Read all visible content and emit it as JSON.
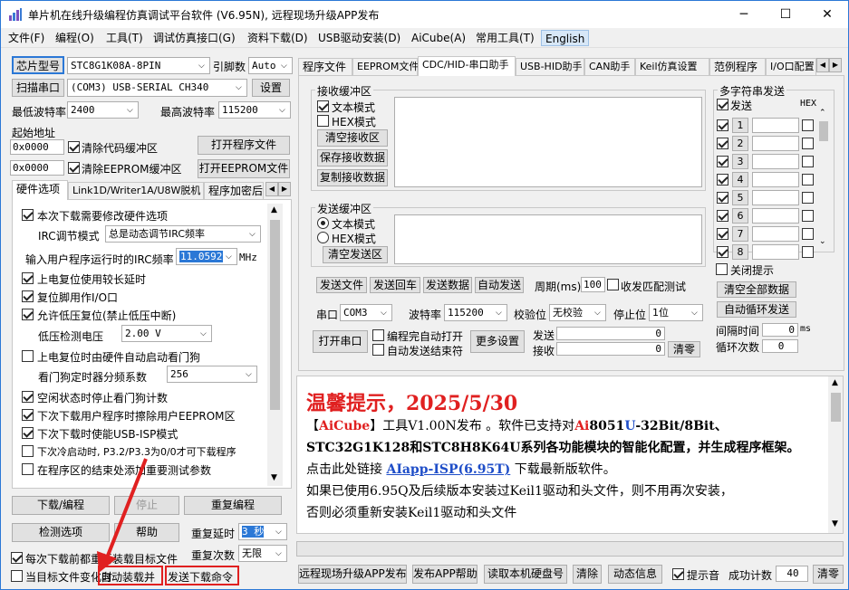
{
  "window": {
    "title": "单片机在线升级编程仿真调试平台软件 (V6.95N), 远程现场升级APP发布"
  },
  "menu": [
    "文件(F)",
    "编程(O)",
    "工具(T)",
    "调试仿真接口(G)",
    "资料下载(D)",
    "USB驱动安装(D)",
    "AiCube(A)",
    "常用工具(T)",
    "English"
  ],
  "left": {
    "chip_btn": "芯片型号",
    "chip_value": "STC8G1K08A-8PIN",
    "pin_label": "引脚数",
    "pin_value": "Auto",
    "scan_btn": "扫描串口",
    "port_value": "(COM3) USB-SERIAL CH340",
    "settings_btn": "设置",
    "min_baud_label": "最低波特率",
    "min_baud_value": "2400",
    "max_baud_label": "最高波特率",
    "max_baud_value": "115200",
    "start_addr_label": "起始地址",
    "addr1": "0x0000",
    "clear_code": "清除代码缓冲区",
    "open_prog": "打开程序文件",
    "addr2": "0x0000",
    "clear_eeprom": "清除EEPROM缓冲区",
    "open_eeprom": "打开EEPROM文件",
    "tabs": [
      "硬件选项",
      "Link1D/Writer1A/U8W脱机",
      "程序加密后"
    ],
    "options": {
      "o1": "本次下载需要修改硬件选项",
      "irc_mode_label": "IRC调节模式",
      "irc_mode_value": "总是动态调节IRC频率",
      "irc_freq_label": "输入用户程序运行时的IRC频率",
      "irc_freq_value": "11.0592",
      "mhz": "MHz",
      "o2": "上电复位使用较长延时",
      "o3": "复位脚用作I/O口",
      "o4": "允许低压复位(禁止低压中断)",
      "lvd_label": "低压检测电压",
      "lvd_value": "2.00 V",
      "o5": "上电复位时由硬件自动启动看门狗",
      "wdt_label": "看门狗定时器分频系数",
      "wdt_value": "256",
      "o6": "空闲状态时停止看门狗计数",
      "o7": "下次下载用户程序时擦除用户EEPROM区",
      "o8": "下次下载时使能USB-ISP模式",
      "o9": "下次冷启动时, P3.2/P3.3为0/0才可下载程序",
      "o10": "在程序区的结束处添加重要测试参数"
    },
    "download_btn": "下载/编程",
    "stop_btn": "停止",
    "reprog_btn": "重复编程",
    "detect_btn": "检测选项",
    "help_btn": "帮助",
    "repeat_delay_label": "重复延时",
    "repeat_delay_value": "3 秒",
    "repeat_count_label": "重复次数",
    "repeat_count_value": "无限",
    "reload_label": "每次下载前都重新装载目标文件",
    "auto_label_a": "当目标文件变化时",
    "auto_label_b": "自动装载并",
    "auto_label_c": "发送下载命令"
  },
  "right": {
    "tabs": [
      "程序文件",
      "EEPROM文件",
      "CDC/HID-串口助手",
      "USB-HID助手",
      "CAN助手",
      "Keil仿真设置",
      "范例程序",
      "I/O口配置"
    ],
    "rx": {
      "title": "接收缓冲区",
      "text_mode": "文本模式",
      "hex_mode": "HEX模式",
      "clear": "清空接收区",
      "save": "保存接收数据",
      "copy": "复制接收数据"
    },
    "tx": {
      "title": "发送缓冲区",
      "text_mode": "文本模式",
      "hex_mode": "HEX模式",
      "clear": "清空发送区"
    },
    "send_file": "发送文件",
    "send_enter": "发送回车",
    "send_data": "发送数据",
    "auto_send": "自动发送",
    "period_label": "周期(ms)",
    "period_value": "100",
    "match_label": "收发匹配测试",
    "port_label": "串口",
    "port_value": "COM3",
    "baud_label": "波特率",
    "baud_value": "115200",
    "parity_label": "校验位",
    "parity_value": "无校验",
    "stop_label": "停止位",
    "stop_value": "1位",
    "open_port": "打开串口",
    "auto_open": "编程完自动打开",
    "auto_close": "自动发送结束符",
    "more": "更多设置",
    "send_label": "发送",
    "send_count": "0",
    "recv_label": "接收",
    "recv_count": "0",
    "clear": "清零",
    "multi": {
      "title": "多字符串发送",
      "send_col": "发送",
      "hex_col": "HEX",
      "rows": [
        "1",
        "2",
        "3",
        "4",
        "5",
        "6",
        "7",
        "8"
      ],
      "close_tip": "关闭提示",
      "clear_all": "清空全部数据",
      "auto_loop": "自动循环发送",
      "interval_label": "间隔时间",
      "interval_value": "0",
      "ms": "ms",
      "loop_label": "循环次数",
      "loop_value": "0"
    }
  },
  "notice": {
    "title": "温馨提示，2025/5/30",
    "l1a": "【",
    "l1b": "AiCube",
    "l1c": "】工具V1.00N发布 。软件已支持对",
    "l1d": "Ai",
    "l1e": "8051",
    "l1f": "U",
    "l1g": "-32Bit/8Bit、",
    "l2": "STC32G1K128和STC8H8K64U系列各功能模块的智能化配置，并生成程序框架。",
    "l3a": "点击此处链接 ",
    "l3b": "AIapp-ISP(6.95T)",
    "l3c": " 下载最新版软件。",
    "l4": "如果已使用6.95Q及后续版本安装过Keil1驱动和头文件，则不用再次安装，",
    "l5": "否则必须重新安装Keil1驱动和头文件"
  },
  "bottom": {
    "remote": "远程现场升级APP发布",
    "publish_help": "发布APP帮助",
    "read_disk": "读取本机硬盘号",
    "clear": "清除",
    "dynamic": "动态信息",
    "beep": "提示音",
    "success_label": "成功计数",
    "success_value": "40",
    "reset": "清零"
  }
}
